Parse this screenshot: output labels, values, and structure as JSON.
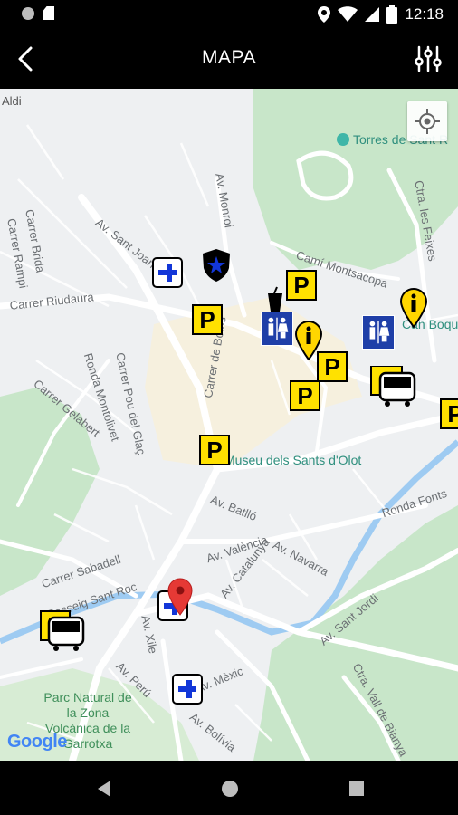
{
  "status_bar": {
    "time": "12:18",
    "icons": [
      "notification-dot-icon",
      "sd-card-icon",
      "location-icon",
      "wifi-icon",
      "signal-icon",
      "battery-icon"
    ]
  },
  "app_bar": {
    "title": "MAPA",
    "back_icon": "chevron-left-icon",
    "filter_icon": "sliders-icon"
  },
  "map": {
    "street_labels": [
      "Aldi",
      "Av. Monroi",
      "Carrer Brida",
      "Carrer Rampi",
      "Av. Sant Joan",
      "Camí Montsacopa",
      "Ctra. les Feixes",
      "Carrer Riudaura",
      "Carrer de Bolòs",
      "Ronda Montolivet",
      "Carrer Pou del Glaç",
      "Carrer Gelabert",
      "Av. Batlló",
      "Av. València",
      "Av. Navarra",
      "Av. Catalunya",
      "Ronda Fonts",
      "Carrer Sabadell",
      "Passeig Sant Roc",
      "Av. Sant Jordi",
      "Av. Xile",
      "Av. Perú",
      "Av. Mèxic",
      "Av. Bolívia",
      "Ctra. Vall de Bianya"
    ],
    "poi_labels": [
      "Torres de Sant R",
      "Can Boqu",
      "Museu dels Sants d'Olot"
    ],
    "park_label": "Parc Natural de la Zona Volcànica de la Garrotxa",
    "attribution": "Google",
    "parking_letter": "P",
    "colors": {
      "map_bg": "#eef0f2",
      "park_green": "#c8e6c9",
      "water_blue": "#9ecbf2",
      "parking_yellow": "#ffe100",
      "first_aid_blue": "#1236d8",
      "pin_red": "#e53935"
    }
  },
  "nav_bar": {
    "icons": [
      "back-triangle-icon",
      "home-circle-icon",
      "recents-square-icon"
    ]
  }
}
